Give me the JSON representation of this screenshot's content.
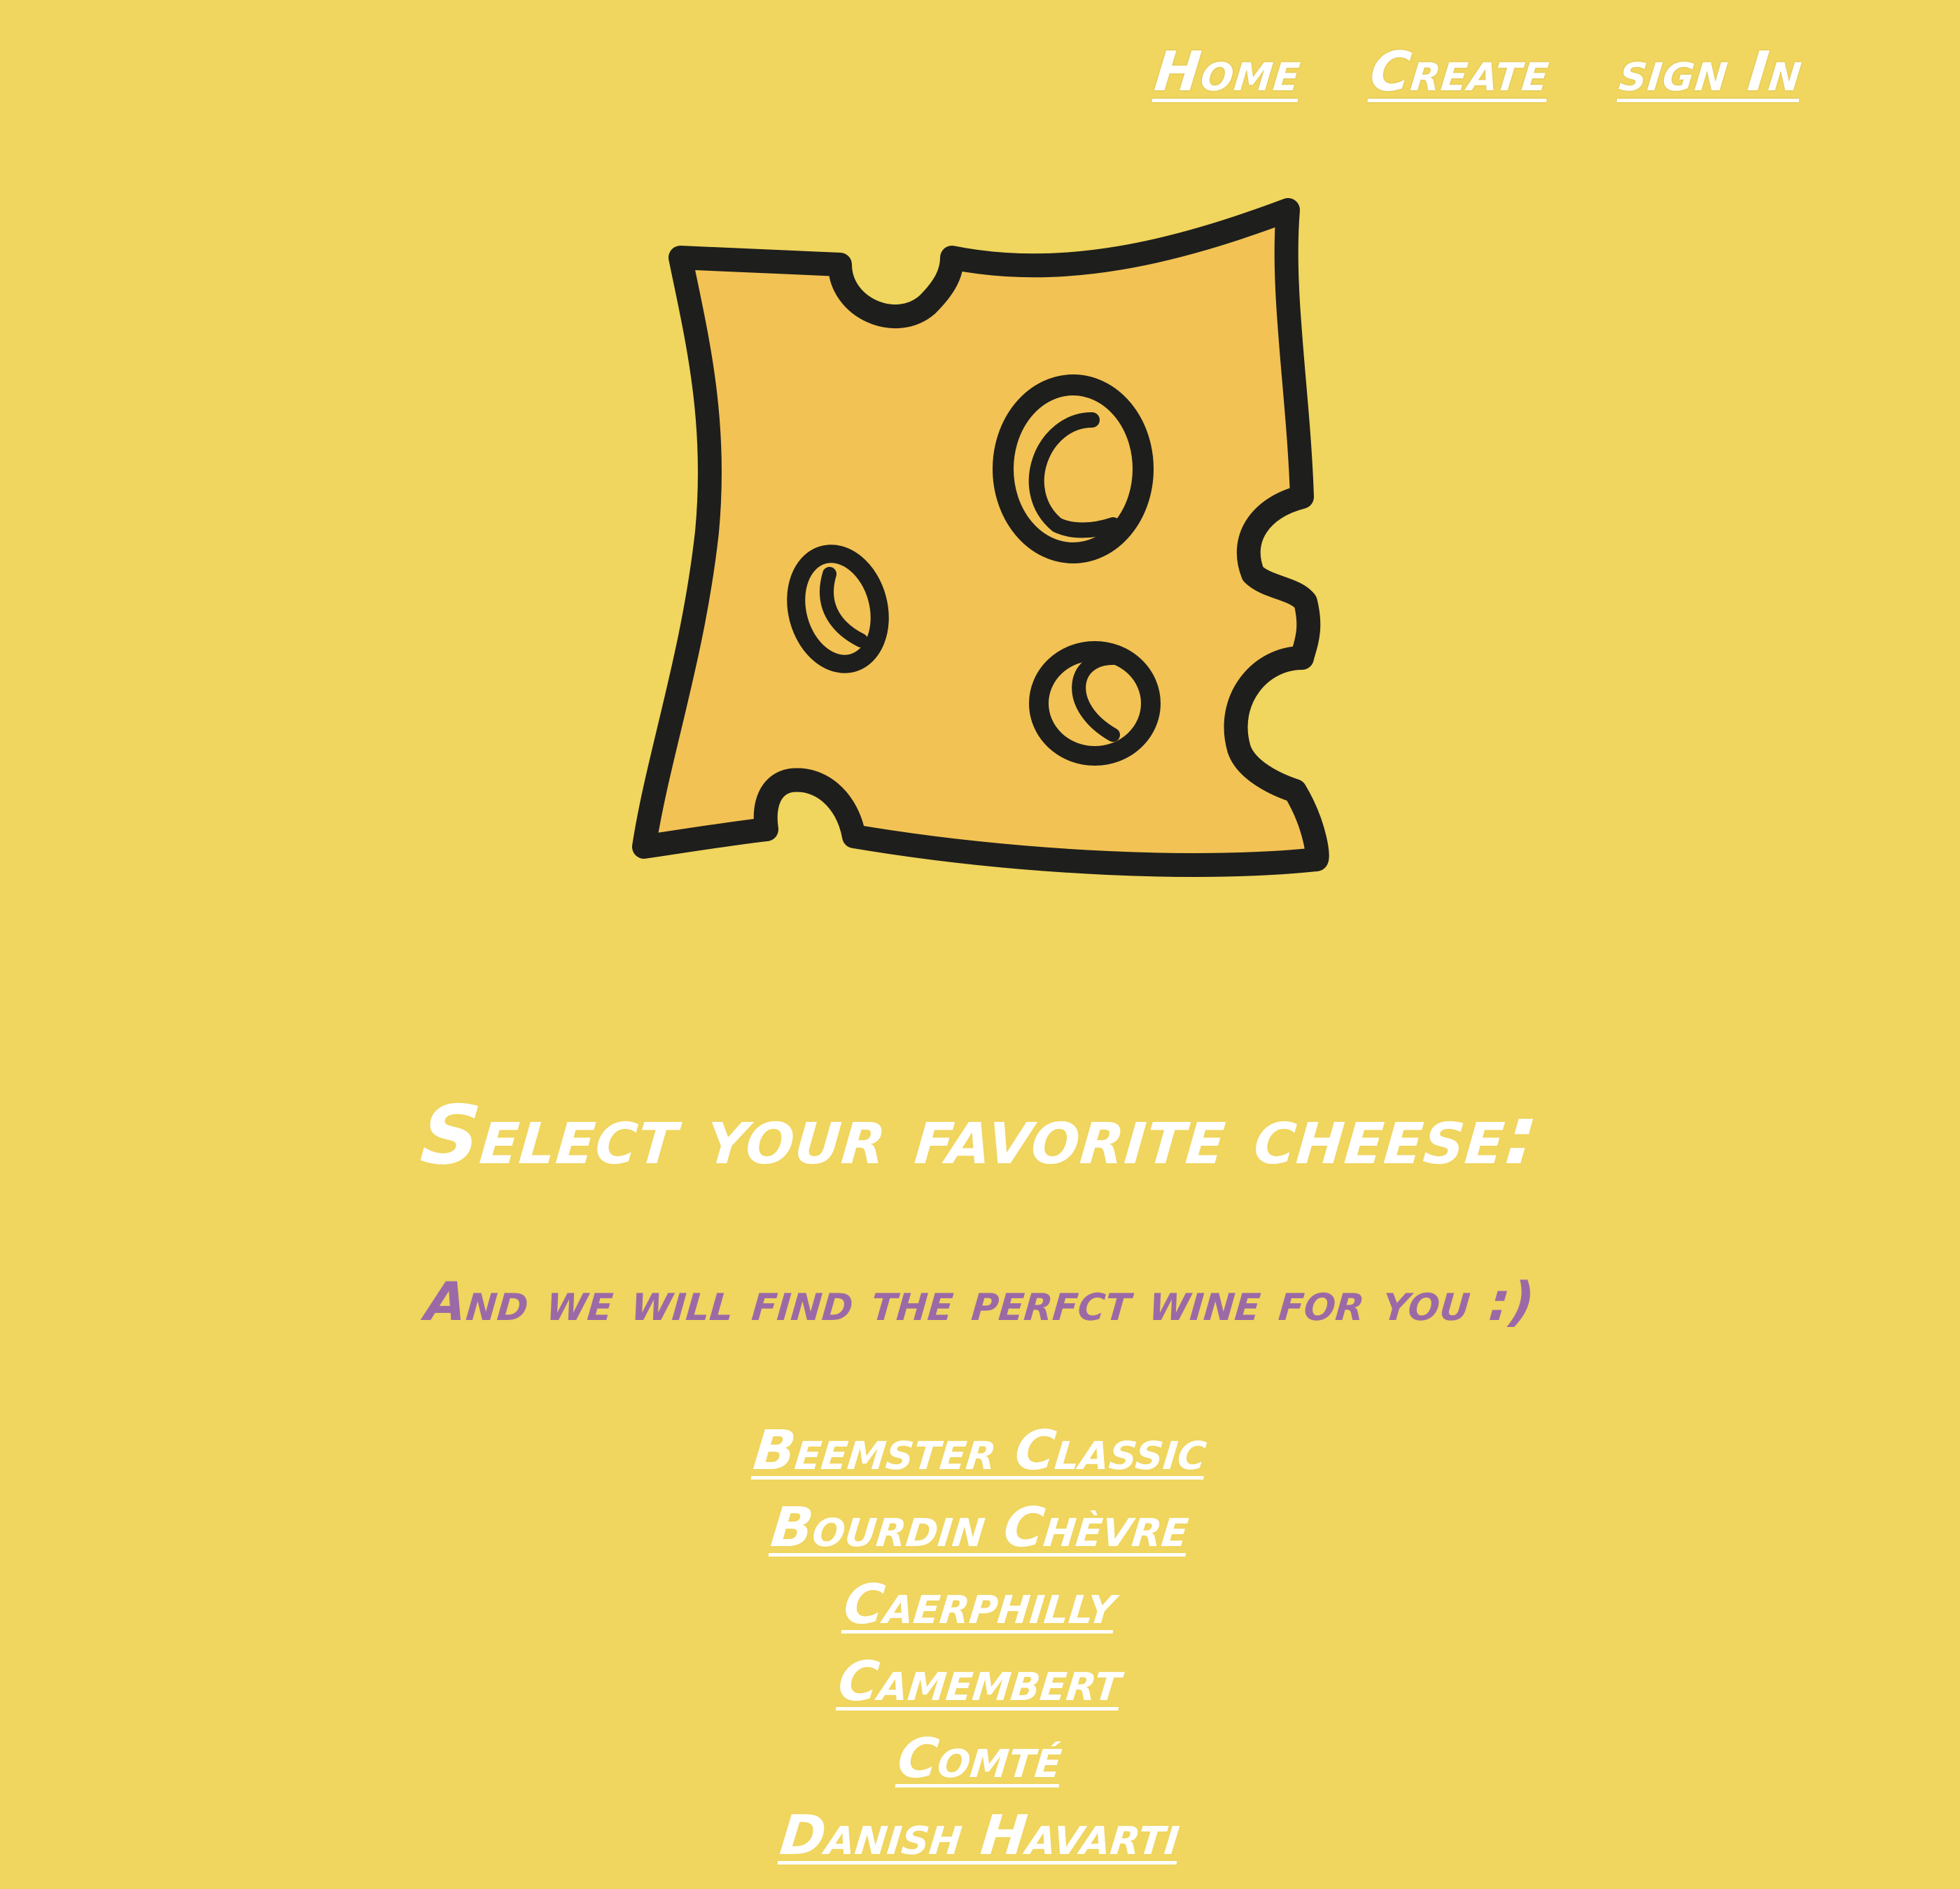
{
  "nav": {
    "items": [
      {
        "label": "Home"
      },
      {
        "label": "Create"
      },
      {
        "label": "sign In"
      }
    ]
  },
  "logo": {
    "icon": "cheese-slice-icon",
    "fill_color": "#f2c254",
    "stroke_color": "#1e1e1c"
  },
  "heading": "Select your favorite cheese:",
  "subheading": "And we will find the perfct wine for you :)",
  "cheeses": [
    {
      "label": "Beemster Classic"
    },
    {
      "label": "Bourdin Chèvre"
    },
    {
      "label": "Caerphilly"
    },
    {
      "label": "Camembert"
    },
    {
      "label": "Comté"
    },
    {
      "label": "Danish Havarti"
    }
  ],
  "colors": {
    "background": "#f0d55e",
    "text": "#ffffff",
    "accent": "#9b6aa6"
  }
}
